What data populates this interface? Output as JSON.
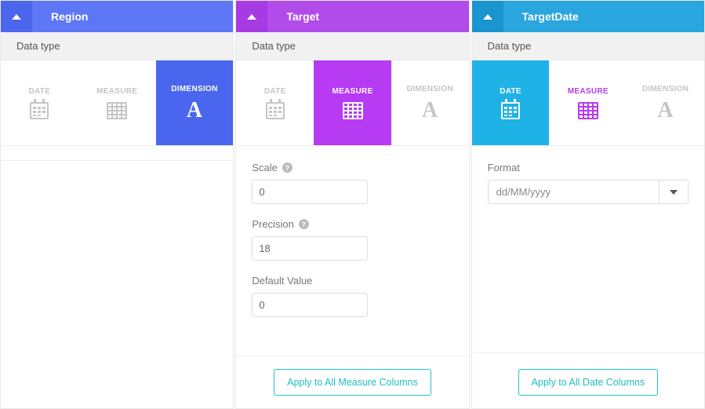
{
  "panels": {
    "region": {
      "title": "Region",
      "section": "Data type",
      "types": {
        "date": "DATE",
        "measure": "MEASURE",
        "dimension": "DIMENSION"
      }
    },
    "target": {
      "title": "Target",
      "section": "Data type",
      "types": {
        "date": "DATE",
        "measure": "MEASURE",
        "dimension": "DIMENSION"
      },
      "scale_label": "Scale",
      "scale_value": "0",
      "precision_label": "Precision",
      "precision_value": "18",
      "default_label": "Default Value",
      "default_value": "0",
      "apply": "Apply to All Measure Columns"
    },
    "targetdate": {
      "title": "TargetDate",
      "section": "Data type",
      "types": {
        "date": "DATE",
        "measure": "MEASURE",
        "dimension": "DIMENSION"
      },
      "format_label": "Format",
      "format_value": "dd/MM/yyyy",
      "apply": "Apply to All Date Columns"
    }
  }
}
